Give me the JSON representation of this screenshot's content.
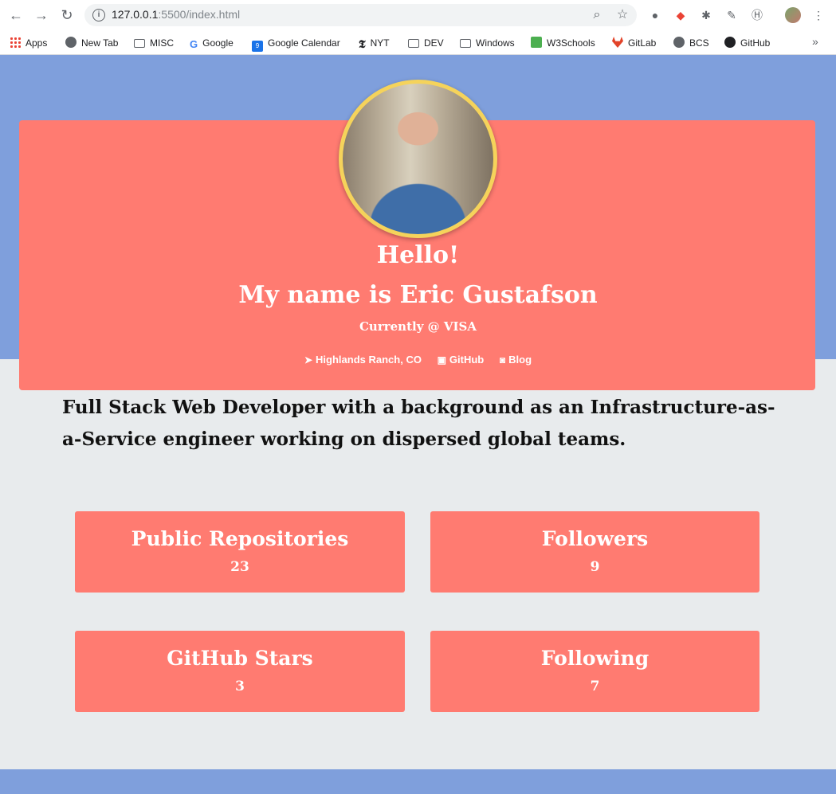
{
  "browser": {
    "url_host": "127.0.0.1",
    "url_rest": ":5500/index.html",
    "bookmarks": [
      {
        "label": "Apps",
        "icon": "apps-icon"
      },
      {
        "label": "New Tab",
        "icon": "globe-icon"
      },
      {
        "label": "MISC",
        "icon": "folder-icon"
      },
      {
        "label": "Google",
        "icon": "google-icon"
      },
      {
        "label": "Google Calendar",
        "icon": "calendar-icon"
      },
      {
        "label": "NYT",
        "icon": "nyt-icon"
      },
      {
        "label": "DEV",
        "icon": "folder-icon"
      },
      {
        "label": "Windows",
        "icon": "folder-icon"
      },
      {
        "label": "W3Schools",
        "icon": "w3schools-icon"
      },
      {
        "label": "GitLab",
        "icon": "gitlab-icon"
      },
      {
        "label": "BCS",
        "icon": "globe-icon"
      },
      {
        "label": "GitHub",
        "icon": "github-icon"
      }
    ],
    "calendar_day": "9",
    "more_glyph": "»"
  },
  "profile": {
    "hello": "Hello!",
    "name": "My name is Eric Gustafson",
    "currently": "Currently @ VISA",
    "location": "Highlands Ranch, CO",
    "github_link": "GitHub",
    "blog_link": "Blog"
  },
  "bio": "Full Stack Web Developer with a background as an Infrastructure-as-a-Service engineer working on dispersed global teams.",
  "stats": {
    "repos": {
      "label": "Public Repositories",
      "value": "23"
    },
    "followers": {
      "label": "Followers",
      "value": "9"
    },
    "stars": {
      "label": "GitHub Stars",
      "value": "3"
    },
    "following": {
      "label": "Following",
      "value": "7"
    }
  },
  "colors": {
    "hero_band": "#7f9fdc",
    "card": "#ff7b71",
    "avatar_border": "#f5d35b",
    "page_bg": "#e8ebed"
  }
}
